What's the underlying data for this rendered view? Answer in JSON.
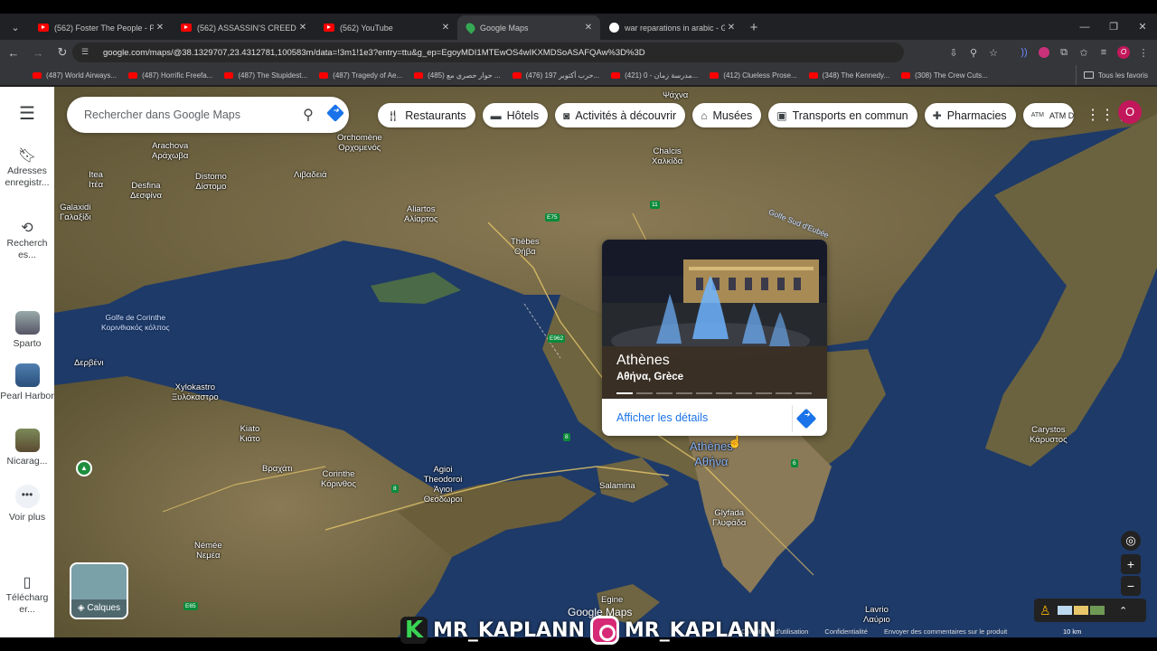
{
  "browser": {
    "tabs": [
      {
        "title": "(562) Foster The People - Pump",
        "icon": "youtube-icon"
      },
      {
        "title": "(562) ASSASSIN'S CREED VALHA",
        "icon": "youtube-icon"
      },
      {
        "title": "(562) YouTube",
        "icon": "youtube-icon"
      },
      {
        "title": "Google Maps",
        "icon": "maps-icon"
      },
      {
        "title": "war reparations in arabic - Goo",
        "icon": "google-icon"
      }
    ],
    "url": "google.com/maps/@38.1329707,23.4312781,100583m/data=!3m1!1e3?entry=ttu&g_ep=EgoyMDI1MTEwOS4wIKXMDSoASAFQAw%3D%3D",
    "bookmarks": [
      "(487) World Airways...",
      "(487) Horrific Freefa...",
      "(487) The Stupidest...",
      "(487) Tragedy of Ae...",
      "(485) حوار حصري مع ...",
      "(476) حرب أكتوبر 197...",
      "(421) مدرسة زمان - 0...",
      "(412) Clueless Prose...",
      "(348) The Kennedy...",
      "(308) The Crew Cuts..."
    ],
    "all_bookmarks": "Tous les favoris",
    "profile_initial": "O"
  },
  "rail": {
    "items": [
      {
        "label": "Adresses enregistr..."
      },
      {
        "label": "Recherch es..."
      },
      {
        "label": "Sparto"
      },
      {
        "label": "Pearl Harbor"
      },
      {
        "label": "Nicarag..."
      },
      {
        "label": "Voir plus"
      },
      {
        "label": "Télécharg er..."
      }
    ]
  },
  "search": {
    "placeholder": "Rechercher dans Google Maps"
  },
  "chips": [
    {
      "label": "Restaurants",
      "icon": "fork-knife-icon"
    },
    {
      "label": "Hôtels",
      "icon": "bed-icon"
    },
    {
      "label": "Activités à découvrir",
      "icon": "camera-icon"
    },
    {
      "label": "Musées",
      "icon": "museum-icon"
    },
    {
      "label": "Transports en commun",
      "icon": "bus-icon"
    },
    {
      "label": "Pharmacies",
      "icon": "pharmacy-icon"
    },
    {
      "label": "ATM D",
      "icon": "atm-icon"
    }
  ],
  "account_initial": "O",
  "card": {
    "title": "Athènes",
    "subtitle": "Αθήνα, Grèce",
    "link": "Afficher les détails",
    "photo_count": 10,
    "active_photo": 1
  },
  "places": [
    {
      "name": "Orchomène",
      "alt": "Ορχομενός"
    },
    {
      "name": "Arachova",
      "alt": "Αράχωβα"
    },
    {
      "name": "Itea",
      "alt": "Ιτέα"
    },
    {
      "name": "Desfina",
      "alt": "Δεσφίνα"
    },
    {
      "name": "Distomo",
      "alt": "Δίστομο"
    },
    {
      "name": "Galaxidi",
      "alt": "Γαλαξίδι"
    },
    {
      "name": "Λιβαδειά",
      "alt": ""
    },
    {
      "name": "Aliartos",
      "alt": "Αλίαρτος"
    },
    {
      "name": "Thèbes",
      "alt": "Θήβα"
    },
    {
      "name": "Chalcis",
      "alt": "Χαλκίδα"
    },
    {
      "name": "Xylokastro",
      "alt": "Ξυλόκαστρο"
    },
    {
      "name": "Kiato",
      "alt": "Κιάτο"
    },
    {
      "name": "Βραχάτι",
      "alt": ""
    },
    {
      "name": "Corinthe",
      "alt": "Κόρινθος"
    },
    {
      "name": "Agioi Theodoroi",
      "alt": "Άγιοι Θεόδωροι"
    },
    {
      "name": "Δερβένι",
      "alt": ""
    },
    {
      "name": "Némée",
      "alt": "Νεμέα"
    },
    {
      "name": "Salamina",
      "alt": ""
    },
    {
      "name": "Athènes",
      "alt": "Αθήνα"
    },
    {
      "name": "Glyfada",
      "alt": "Γλυφάδα"
    },
    {
      "name": "Carystos",
      "alt": "Κάρυστος"
    },
    {
      "name": "Egine",
      "alt": ""
    },
    {
      "name": "Lavrio",
      "alt": "Λαύριο"
    },
    {
      "name": "Ψάχνα",
      "alt": ""
    }
  ],
  "seas": [
    {
      "name": "Golfe de Corinthe",
      "alt": "Κορινθιακός κόλπος"
    },
    {
      "name": "Golfe Sud d'Eubée",
      "alt": ""
    }
  ],
  "roads": [
    "E75",
    "11",
    "E962",
    "8",
    "8",
    "6",
    "E65"
  ],
  "controls": {
    "layers_label": "Calques",
    "zoom_in": "+",
    "zoom_out": "−"
  },
  "footer": {
    "links": [
      "Conditions d'utilisation",
      "Confidentialité",
      "Envoyer des commentaires sur le produit"
    ],
    "scale": "10 km",
    "logo": "Google Maps"
  },
  "watermark": {
    "text1": "MR_KAPLANN",
    "text2": "MR_KAPLANN"
  }
}
